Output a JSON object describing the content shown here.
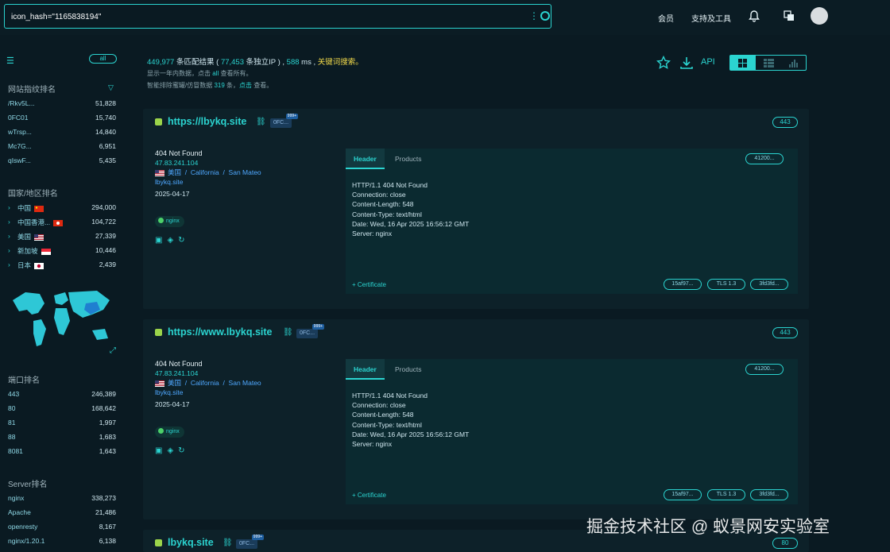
{
  "search": {
    "query": "icon_hash=\"1165838194\""
  },
  "topnav": {
    "member": "会员",
    "support": "支持及工具"
  },
  "sidebar": {
    "all_label": "all",
    "fingerprint_title": "网站指纹排名",
    "fingerprints": [
      {
        "k": "/Rkv5L...",
        "v": "51,828"
      },
      {
        "k": "0FC01",
        "v": "15,740"
      },
      {
        "k": "wTrsp...",
        "v": "14,840"
      },
      {
        "k": "Mc7G...",
        "v": "6,951"
      },
      {
        "k": "qIswF...",
        "v": "5,435"
      }
    ],
    "country_title": "国家/地区排名",
    "countries": [
      {
        "k": "中国",
        "v": "294,000",
        "flag": "cn"
      },
      {
        "k": "中国香港...",
        "v": "104,722",
        "flag": "hk"
      },
      {
        "k": "美国",
        "v": "27,339",
        "flag": "us"
      },
      {
        "k": "新加坡",
        "v": "10,446",
        "flag": "sg"
      },
      {
        "k": "日本",
        "v": "2,439",
        "flag": "jp"
      }
    ],
    "port_title": "端口排名",
    "ports": [
      {
        "k": "443",
        "v": "246,389"
      },
      {
        "k": "80",
        "v": "168,642"
      },
      {
        "k": "81",
        "v": "1,997"
      },
      {
        "k": "88",
        "v": "1,683"
      },
      {
        "k": "8081",
        "v": "1,643"
      }
    ],
    "server_title": "Server排名",
    "servers": [
      {
        "k": "nginx",
        "v": "338,273"
      },
      {
        "k": "Apache",
        "v": "21,486"
      },
      {
        "k": "openresty",
        "v": "8,167"
      },
      {
        "k": "nginx/1.20.1",
        "v": "6,138"
      }
    ]
  },
  "summary": {
    "total": "449,977",
    "t1": " 条匹配结果 ( ",
    "unique": "77,453",
    "t2": " 条独立IP ) , ",
    "ms": "588",
    "t3": " ms , ",
    "kw": "关键词搜索。",
    "sub1a": "显示一年内数据，点击 ",
    "sub1b": "all",
    "sub1c": " 查看所有。",
    "sub2a": "智能排除蜜罐/仿冒数据 ",
    "sub2b": "319",
    "sub2c": " 条，",
    "sub2d": "点击",
    "sub2e": " 查看。"
  },
  "tools": {
    "api": "API"
  },
  "cards": [
    {
      "url": "https://lbykq.site",
      "tag": "0FC...",
      "tag_sup": "999+",
      "port": "443",
      "status": "404 Not Found",
      "ip": "47.83.241.104",
      "country": "美国",
      "region": "California",
      "city": "San Mateo",
      "host": "lbykq.site",
      "date": "2025-04-17",
      "server": "nginx",
      "tab_header": "Header",
      "tab_products": "Products",
      "hash_pill": "41200...",
      "header_lines": [
        "HTTP/1.1 404 Not Found",
        "Connection: close",
        "Content-Length: 548",
        "Content-Type: text/html",
        "Date: Wed, 16 Apr 2025 16:56:12 GMT",
        "Server: nginx"
      ],
      "cert": "+ Certificate",
      "pills": [
        "15af97...",
        "TLS 1.3",
        "3fd3fd..."
      ]
    },
    {
      "url": "https://www.lbykq.site",
      "tag": "0FC...",
      "tag_sup": "999+",
      "port": "443",
      "status": "404 Not Found",
      "ip": "47.83.241.104",
      "country": "美国",
      "region": "California",
      "city": "San Mateo",
      "host": "lbykq.site",
      "date": "2025-04-17",
      "server": "nginx",
      "tab_header": "Header",
      "tab_products": "Products",
      "hash_pill": "41200...",
      "header_lines": [
        "HTTP/1.1 404 Not Found",
        "Connection: close",
        "Content-Length: 548",
        "Content-Type: text/html",
        "Date: Wed, 16 Apr 2025 16:56:12 GMT",
        "Server: nginx"
      ],
      "cert": "+ Certificate",
      "pills": [
        "15af97...",
        "TLS 1.3",
        "3fd3fd..."
      ]
    },
    {
      "url": "lbykq.site",
      "tag": "0FC...",
      "tag_sup": "999+",
      "port": "80"
    }
  ],
  "watermark": "掘金技术社区 @ 蚁景网安实验室",
  "colors": {
    "accent": "#2bd4d0",
    "bg": "#0a1a22",
    "card": "#0d2129",
    "keyword": "#f0d84a"
  }
}
